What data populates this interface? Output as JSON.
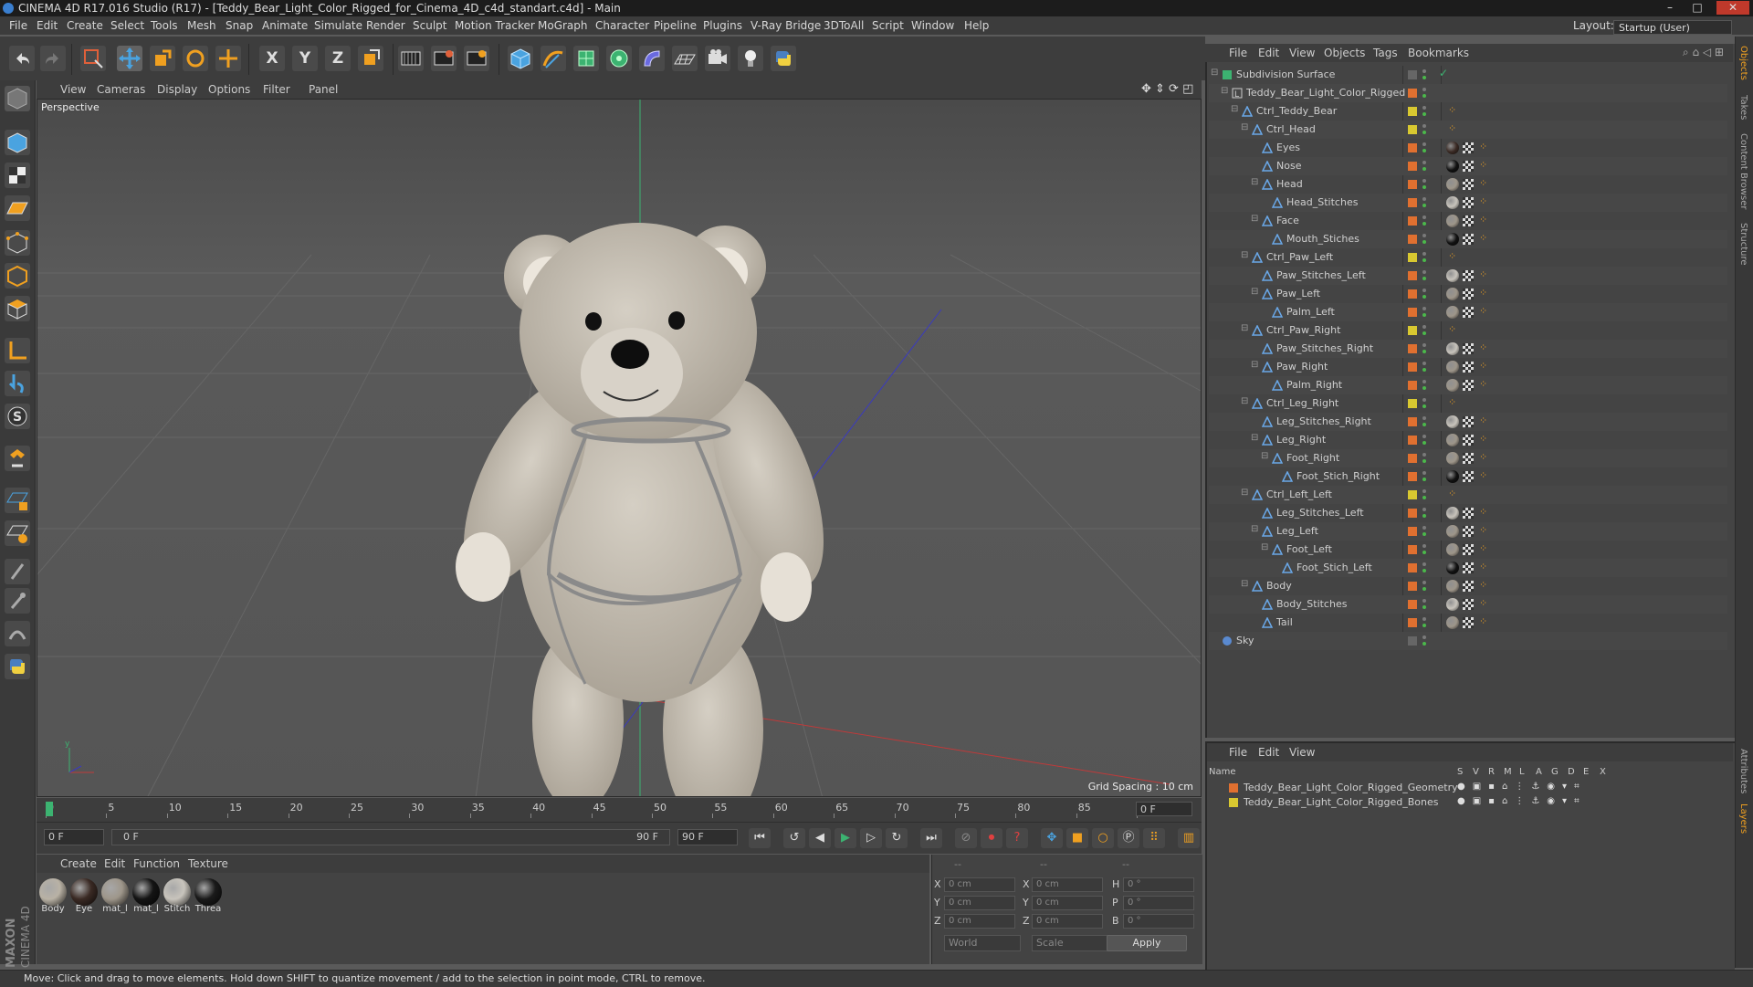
{
  "window": {
    "title": "CINEMA 4D R17.016 Studio (R17) - [Teddy_Bear_Light_Color_Rigged_for_Cinema_4D_c4d_standart.c4d] - Main",
    "controls": [
      "–",
      "□",
      "✕"
    ]
  },
  "menubar": {
    "items": [
      "File",
      "Edit",
      "Create",
      "Select",
      "Tools",
      "Mesh",
      "Snap",
      "Animate",
      "Simulate",
      "Render",
      "Sculpt",
      "Motion Tracker",
      "MoGraph",
      "Character",
      "Pipeline",
      "Plugins",
      "V-Ray Bridge",
      "3DToAll",
      "Script",
      "Window",
      "Help"
    ],
    "layout_label": "Layout:",
    "layout_value": "Startup (User)"
  },
  "toolbar": {
    "axis_x": "X",
    "axis_y": "Y",
    "axis_z": "Z"
  },
  "viewport": {
    "menu": [
      "View",
      "Cameras",
      "Display",
      "Options",
      "Filter",
      "Panel"
    ],
    "label": "Perspective",
    "grid_spacing": "Grid Spacing : 10 cm"
  },
  "timeline": {
    "ticks": [
      "0",
      "5",
      "10",
      "15",
      "20",
      "25",
      "30",
      "35",
      "40",
      "45",
      "50",
      "55",
      "60",
      "65",
      "70",
      "75",
      "80",
      "85",
      "90"
    ],
    "current_frame": "0 F"
  },
  "transport": {
    "start_field": "0 F",
    "range_start": "0 F",
    "range_end": "90 F",
    "end_field": "90 F"
  },
  "materials": {
    "menu": [
      "Create",
      "Edit",
      "Function",
      "Texture"
    ],
    "items": [
      {
        "label": "Body",
        "color": "#b9b2a5"
      },
      {
        "label": "Eye",
        "color": "#3a2a24"
      },
      {
        "label": "mat_l",
        "color": "#9e968a"
      },
      {
        "label": "mat_l",
        "color": "#141414"
      },
      {
        "label": "Stitch",
        "color": "#c8c4bc"
      },
      {
        "label": "Threa",
        "color": "#1a1a1a"
      }
    ]
  },
  "coordinates": {
    "header": [
      "--",
      "--",
      "--"
    ],
    "rows": [
      {
        "a": "X",
        "av": "0 cm",
        "b": "X",
        "bv": "0 cm",
        "c": "H",
        "cv": "0 °"
      },
      {
        "a": "Y",
        "av": "0 cm",
        "b": "Y",
        "bv": "0 cm",
        "c": "P",
        "cv": "0 °"
      },
      {
        "a": "Z",
        "av": "0 cm",
        "b": "Z",
        "bv": "0 cm",
        "c": "B",
        "cv": "0 °"
      }
    ],
    "space": "World",
    "mode": "Scale",
    "apply": "Apply"
  },
  "status": "Move: Click and drag to move elements. Hold down SHIFT to quantize movement / add to the selection in point mode, CTRL to remove.",
  "object_manager": {
    "menu": [
      "File",
      "Edit",
      "View",
      "Objects",
      "Tags",
      "Bookmarks"
    ],
    "objects": [
      {
        "name": "Subdivision Surface",
        "depth": 0,
        "kind": "subdiv",
        "swatch": "none",
        "tags": "check"
      },
      {
        "name": "Teddy_Bear_Light_Color_Rigged",
        "depth": 1,
        "kind": "null",
        "swatch": "#e07030",
        "tags": "none"
      },
      {
        "name": "Ctrl_Teddy_Bear",
        "depth": 2,
        "kind": "bone",
        "swatch": "#d8c830",
        "tags": "ik"
      },
      {
        "name": "Ctrl_Head",
        "depth": 3,
        "kind": "bone",
        "swatch": "#d8c830",
        "tags": "ik"
      },
      {
        "name": "Eyes",
        "depth": 4,
        "kind": "bone",
        "swatch": "#e07030",
        "tags": "dark"
      },
      {
        "name": "Nose",
        "depth": 4,
        "kind": "bone",
        "swatch": "#e07030",
        "tags": "black"
      },
      {
        "name": "Head",
        "depth": 4,
        "kind": "bone",
        "swatch": "#e07030",
        "tags": "fur"
      },
      {
        "name": "Head_Stitches",
        "depth": 5,
        "kind": "bone",
        "swatch": "#e07030",
        "tags": "light"
      },
      {
        "name": "Face",
        "depth": 4,
        "kind": "bone",
        "swatch": "#e07030",
        "tags": "fur"
      },
      {
        "name": "Mouth_Stiches",
        "depth": 5,
        "kind": "bone",
        "swatch": "#e07030",
        "tags": "black"
      },
      {
        "name": "Ctrl_Paw_Left",
        "depth": 3,
        "kind": "bone",
        "swatch": "#d8c830",
        "tags": "ik"
      },
      {
        "name": "Paw_Stitches_Left",
        "depth": 4,
        "kind": "bone",
        "swatch": "#e07030",
        "tags": "light"
      },
      {
        "name": "Paw_Left",
        "depth": 4,
        "kind": "bone",
        "swatch": "#e07030",
        "tags": "fur"
      },
      {
        "name": "Palm_Left",
        "depth": 5,
        "kind": "bone",
        "swatch": "#e07030",
        "tags": "fur"
      },
      {
        "name": "Ctrl_Paw_Right",
        "depth": 3,
        "kind": "bone",
        "swatch": "#d8c830",
        "tags": "ik"
      },
      {
        "name": "Paw_Stitches_Right",
        "depth": 4,
        "kind": "bone",
        "swatch": "#e07030",
        "tags": "light"
      },
      {
        "name": "Paw_Right",
        "depth": 4,
        "kind": "bone",
        "swatch": "#e07030",
        "tags": "fur"
      },
      {
        "name": "Palm_Right",
        "depth": 5,
        "kind": "bone",
        "swatch": "#e07030",
        "tags": "fur"
      },
      {
        "name": "Ctrl_Leg_Right",
        "depth": 3,
        "kind": "bone",
        "swatch": "#d8c830",
        "tags": "ik"
      },
      {
        "name": "Leg_Stitches_Right",
        "depth": 4,
        "kind": "bone",
        "swatch": "#e07030",
        "tags": "light"
      },
      {
        "name": "Leg_Right",
        "depth": 4,
        "kind": "bone",
        "swatch": "#e07030",
        "tags": "fur"
      },
      {
        "name": "Foot_Right",
        "depth": 5,
        "kind": "bone",
        "swatch": "#e07030",
        "tags": "fur"
      },
      {
        "name": "Foot_Stich_Right",
        "depth": 6,
        "kind": "bone",
        "swatch": "#e07030",
        "tags": "black"
      },
      {
        "name": "Ctrl_Left_Left",
        "depth": 3,
        "kind": "bone",
        "swatch": "#d8c830",
        "tags": "ik"
      },
      {
        "name": "Leg_Stitches_Left",
        "depth": 4,
        "kind": "bone",
        "swatch": "#e07030",
        "tags": "light"
      },
      {
        "name": "Leg_Left",
        "depth": 4,
        "kind": "bone",
        "swatch": "#e07030",
        "tags": "fur"
      },
      {
        "name": "Foot_Left",
        "depth": 5,
        "kind": "bone",
        "swatch": "#e07030",
        "tags": "fur"
      },
      {
        "name": "Foot_Stich_Left",
        "depth": 6,
        "kind": "bone",
        "swatch": "#e07030",
        "tags": "black"
      },
      {
        "name": "Body",
        "depth": 3,
        "kind": "bone",
        "swatch": "#e07030",
        "tags": "fur"
      },
      {
        "name": "Body_Stitches",
        "depth": 4,
        "kind": "bone",
        "swatch": "#e07030",
        "tags": "light"
      },
      {
        "name": "Tail",
        "depth": 4,
        "kind": "bone",
        "swatch": "#e07030",
        "tags": "fur"
      },
      {
        "name": "Sky",
        "depth": 0,
        "kind": "sky",
        "swatch": "none",
        "tags": "none"
      }
    ]
  },
  "layer_manager": {
    "menu": [
      "File",
      "Edit",
      "View"
    ],
    "columns": [
      "Name",
      "S",
      "V",
      "R",
      "M",
      "L",
      "A",
      "G",
      "D",
      "E",
      "X"
    ],
    "layers": [
      {
        "name": "Teddy_Bear_Light_Color_Rigged_Geometry",
        "color": "#e07030"
      },
      {
        "name": "Teddy_Bear_Light_Color_Rigged_Bones",
        "color": "#d8c830"
      }
    ]
  },
  "right_tabs": [
    "Objects",
    "Takes",
    "Content Browser",
    "Structure",
    "Attributes",
    "Layers"
  ],
  "branding": "MAXON CINEMA 4D"
}
